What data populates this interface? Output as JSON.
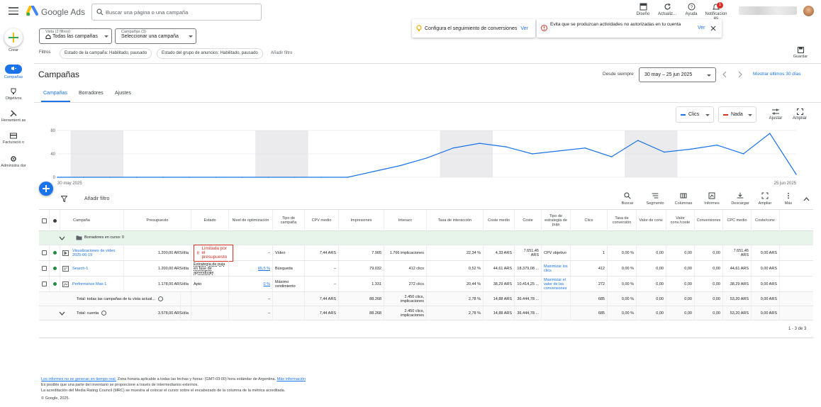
{
  "header": {
    "brand": "Google Ads",
    "search_placeholder": "Buscar una página o una campaña",
    "tools": [
      {
        "icon": "appearance-icon",
        "label": "Diseño"
      },
      {
        "icon": "refresh-icon",
        "label": "Actualiz..."
      },
      {
        "icon": "help-icon",
        "label": "Ayuda"
      },
      {
        "icon": "bell-icon",
        "label": "Notificacion es",
        "badge": "1"
      }
    ]
  },
  "rail": [
    {
      "label": "Crear"
    },
    {
      "label": "Campañas"
    },
    {
      "label": "Objetivos"
    },
    {
      "label": "Herramient as"
    },
    {
      "label": "Facturació n"
    },
    {
      "label": "Administra dor"
    }
  ],
  "view_selector": {
    "label": "Vista (2 filtros)",
    "value": "Todas las campañas"
  },
  "campaign_selector": {
    "label": "Campañas (3)",
    "value": "Seleccionar una campaña"
  },
  "notices": [
    {
      "text": "Configura el seguimiento de conversiones",
      "link": "Ver"
    },
    {
      "text": "Evita que se produzcan actividades no autorizadas en tu cuenta",
      "link": "Ver"
    }
  ],
  "filters": {
    "label": "Filtros",
    "chips": [
      "Estado de la campaña: Habilitado, pausado",
      "Estado del grupo de anuncios: Habilitado, pausado"
    ],
    "add": "Añadir filtro"
  },
  "save_label": "Guardar",
  "page_title": "Campañas",
  "date": {
    "prefix": "Desde siempre",
    "range": "30 may – 25 jun 2025",
    "show_last": "Mostrar últimos 30 días"
  },
  "tabs": [
    "Campañas",
    "Borradores",
    "Ajustes"
  ],
  "chart_controls": {
    "metric1": "Clics",
    "metric2": "Nada",
    "adjust": "Ajustar",
    "expand": "Ampliar"
  },
  "chart_data": {
    "type": "line",
    "x_start": "30 may 2025",
    "x_end": "25 jun 2025",
    "ylim": [
      0,
      80
    ],
    "yticks": [
      "80",
      "40",
      "0"
    ],
    "series": [
      {
        "values": [
          0,
          0,
          0,
          0,
          0,
          0,
          0,
          0,
          0,
          0,
          0,
          0,
          10,
          20,
          33,
          50,
          58,
          52,
          40,
          45,
          50,
          35,
          63,
          43,
          48,
          55,
          40,
          75,
          5
        ]
      }
    ]
  },
  "table_toolbar": {
    "add_filter": "Añadir filtro",
    "buttons": [
      "Buscar",
      "Segmento",
      "Columnas",
      "Informes",
      "Descargar",
      "Ampliar",
      "Más"
    ]
  },
  "columns": [
    "Campaña",
    "Presupuesto",
    "Estado",
    "Nivel de optimización",
    "Tipo de campaña",
    "CPV medio",
    "Impresiones",
    "Interacc",
    "Tasa de interacción",
    "Coste medio",
    "Coste",
    "Tipo de estrategia de puja",
    "Clics",
    "Tasa de conversión",
    "Valor de conv.",
    "Valor conv./coste",
    "Conversiones",
    "CPC medio",
    "Coste/conv."
  ],
  "draft_row": "Borradores en curso: 0",
  "rows": [
    {
      "name": "Visualizaciones de vídeo 2025-06-19",
      "budget": "1.200,00 ARS/día",
      "status": "Limitada por el presupuesto",
      "opt": "–",
      "type": "Vídeo",
      "cpv": "7,44 ARS",
      "impr": "7.905",
      "inter": "1.766 implicaciones",
      "rate": "22,34 %",
      "avg": "4,33 ARS",
      "cost": "7.651,45 ARS",
      "bid": "CPV objetivo",
      "clicks": "1",
      "convrate": "0,00 %",
      "convval": "0,00",
      "valcost": "0,00",
      "conv": "0,00",
      "cpc": "7.651,45 ARS",
      "costconv": "0,00 ARS"
    },
    {
      "name": "Search-1",
      "budget": "1.200,00 ARS/día",
      "status": "Estrategia de puja en fase de aprendizaje",
      "opt": "65,5 %",
      "type": "Búsqueda",
      "cpv": "–",
      "impr": "79.032",
      "inter": "412 clics",
      "rate": "0,52 %",
      "avg": "44,61 ARS",
      "cost": "18.379,08 ...",
      "bid": "Maximizar los clics",
      "clicks": "412",
      "convrate": "0,00 %",
      "convval": "0,00",
      "valcost": "0,00",
      "conv": "0,00",
      "cpc": "44,61 ARS",
      "costconv": "0,00 ARS"
    },
    {
      "name": "Performance Max-1",
      "budget": "1.178,00 ARS/día",
      "status": "Apto",
      "opt": "0 %",
      "type": "Máximo rendimiento",
      "cpv": "–",
      "impr": "1.331",
      "inter": "272 clics",
      "rate": "20,44 %",
      "avg": "38,29 ARS",
      "cost": "10.414,25 ...",
      "bid": "Maximizar el valor de las conversiones",
      "clicks": "272",
      "convrate": "0,00 %",
      "convval": "0,00",
      "valcost": "0,00",
      "conv": "0,00",
      "cpc": "38,29 ARS",
      "costconv": "0,00 ARS"
    }
  ],
  "totals": [
    {
      "label": "Total: todas las campañas de tu vista actual...",
      "budget": "",
      "opt": "–",
      "cpv": "7,44 ARS",
      "impr": "88.268",
      "inter": "2.450 clics, implicaciones",
      "rate": "2,78 %",
      "avg": "14,88 ARS",
      "cost": "36.444,78 ...",
      "clicks": "685",
      "convrate": "0,00 %",
      "convval": "0,00",
      "valcost": "0,00",
      "conv": "0,00",
      "cpc": "53,20 ARS",
      "costconv": "0,00 ARS"
    },
    {
      "label": "Total: cuenta",
      "budget": "3.578,00 ARS/día",
      "opt": "–",
      "cpv": "7,44 ARS",
      "impr": "88.268",
      "inter": "2.450 clics, implicaciones",
      "rate": "2,78 %",
      "avg": "14,88 ARS",
      "cost": "36.444,78 ...",
      "clicks": "685",
      "convrate": "0,00 %",
      "convval": "0,00",
      "valcost": "0,00",
      "conv": "0,00",
      "cpc": "53,20 ARS",
      "costconv": "0,00 ARS"
    }
  ],
  "pagination": "1 - 3 de 3",
  "footer": {
    "line1_link": "Los informes no se generan en tiempo real.",
    "line1_text": " Zona horaria aplicable a todas las fechas y horas: (GMT-03:00) hora estándar de Argentina. ",
    "line1_more": "Más información",
    "line2": "Es posible que una parte del inventario se proporcione a través de intermediarios externos.",
    "line3": "La acreditación del Media Rating Council (MRC) se muestra al colocar el cursor sobre el encabezado de la columna de la métrica acreditada.",
    "copyright": "© Google, 2025."
  },
  "colors": {
    "accent": "#1a73e8",
    "error": "#d93025",
    "enabled": "#1e8e3e",
    "draft_bg": "#e6f4ea"
  }
}
